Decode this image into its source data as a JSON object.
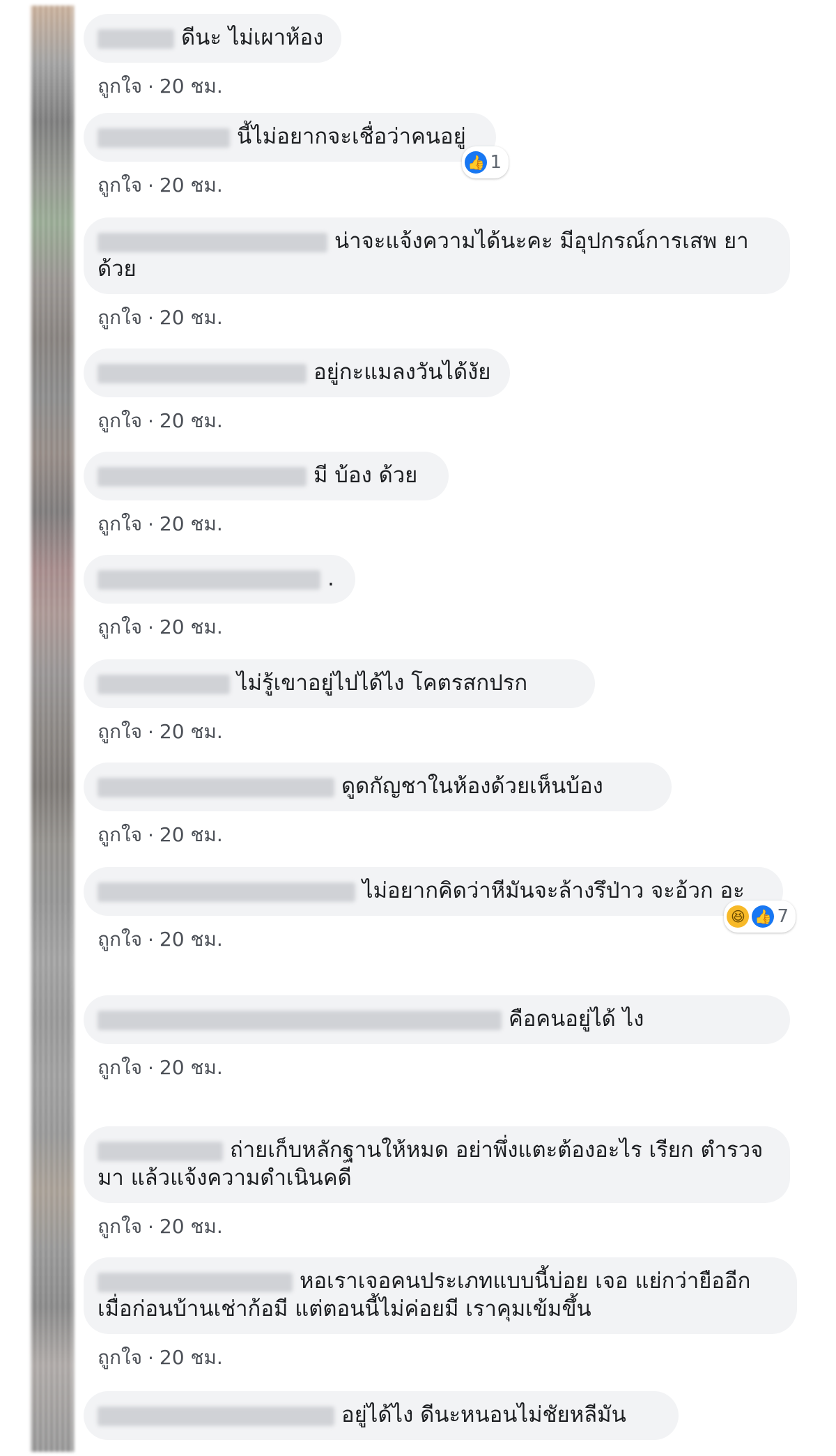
{
  "meta": {
    "like_label": "ถูกใจ",
    "separator": "·",
    "time": "20 ชม."
  },
  "reaction_icons": {
    "like": "like-icon",
    "haha": "haha-icon"
  },
  "comments": [
    {
      "text": "ดีนะ ไม่เผาห้อง"
    },
    {
      "text": "นี้ไม่อยากจะเชื่อว่าคนอยู่",
      "reactions": {
        "count": "1"
      }
    },
    {
      "text": "น่าจะแจ้งความได้นะคะ มีอุปกรณ์การเสพ ยาด้วย"
    },
    {
      "text": "อยู่กะแมลงวันได้งัย"
    },
    {
      "text": "มี บ้อง ด้วย"
    },
    {
      "text": "."
    },
    {
      "text": "ไม่รู้เขาอยู่ไปได้ไง โคตรสกปรก"
    },
    {
      "text": "ดูดกัญชาในห้องด้วยเห็นบ้อง"
    },
    {
      "text": "ไม่อยากคิดว่าหีมันจะล้างรึป่าว จะอ้วก อะ",
      "reactions": {
        "count": "7"
      }
    },
    {
      "text": "คือคนอยู่ได้ ไง"
    },
    {
      "text": "ถ่ายเก็บหลักฐานให้หมด อย่าพึ่งแตะต้องอะไร เรียก ตำรวจมา แล้วแจ้งความดำเนินคดี"
    },
    {
      "text": "หอเราเจอคนประเภทแบบนี้บ่อย เจอ แย่กว่ายืออีก เมื่อก่อนบ้านเช่าก้อมี แต่ตอนนี้ไม่ค่อยมี เราคุมเข้มขึ้น"
    },
    {
      "text": "อยู่ได้ไง ดีนะหนอนไม่ชัยหลีมัน"
    }
  ]
}
